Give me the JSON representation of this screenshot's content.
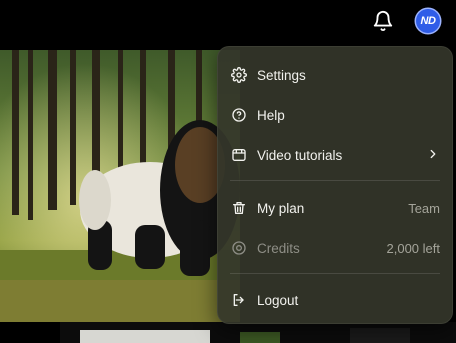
{
  "header": {
    "avatar_initials": "ND",
    "icons": [
      "bell-icon"
    ]
  },
  "menu": {
    "items": [
      {
        "label": "Settings",
        "icon": "gear-icon"
      },
      {
        "label": "Help",
        "icon": "help-circle-icon"
      },
      {
        "label": "Video tutorials",
        "icon": "video-icon",
        "has_submenu": true
      },
      {
        "label": "My plan",
        "icon": "trash-icon",
        "value": "Team"
      },
      {
        "label": "Credits",
        "icon": "coin-icon",
        "value": "2,000 left"
      },
      {
        "label": "Logout",
        "icon": "logout-icon"
      }
    ]
  },
  "colors": {
    "avatar_bg": "#2f5de8",
    "menu_bg": "#34362a",
    "text": "#f2f2ee",
    "muted": "#a4a49a"
  }
}
